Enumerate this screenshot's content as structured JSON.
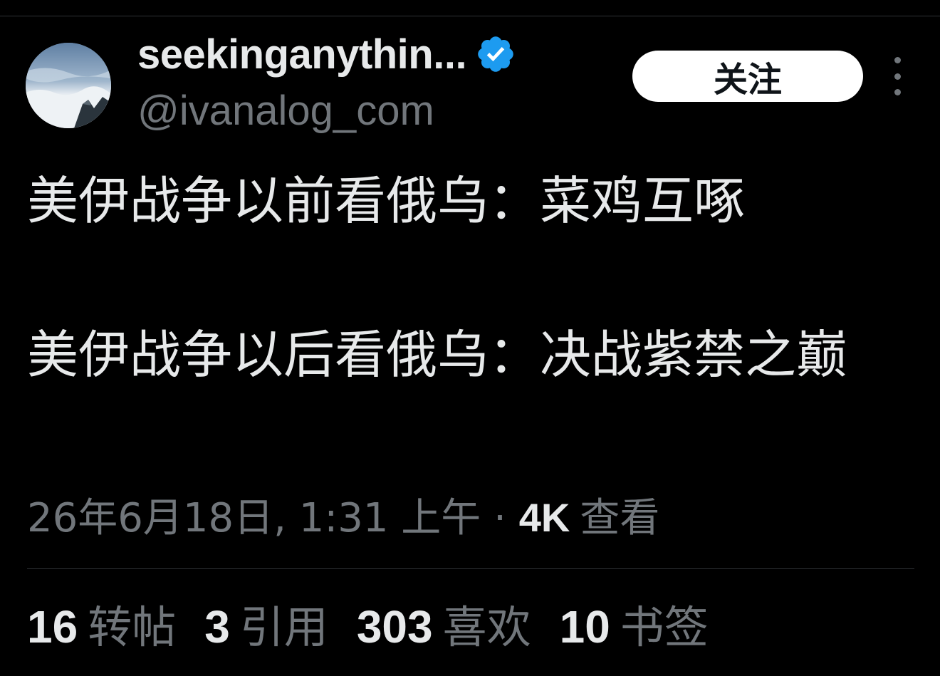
{
  "author": {
    "display_name": "seekinganythin...",
    "handle": "@ivanalog_com",
    "verified": true,
    "verified_color": "#1d9bf0"
  },
  "actions": {
    "follow_label": "关注",
    "more_icon": "more-vertical-icon"
  },
  "tweet": {
    "text": "美伊战争以前看俄乌：菜鸡互啄\n\n美伊战争以后看俄乌：决战紫禁之巅"
  },
  "meta": {
    "timestamp": "26年6月18日, 1:31 上午",
    "separator": " · ",
    "views_count": "4K",
    "views_label": "查看"
  },
  "stats": [
    {
      "count": "16",
      "label": "转帖"
    },
    {
      "count": "3",
      "label": "引用"
    },
    {
      "count": "303",
      "label": "喜欢"
    },
    {
      "count": "10",
      "label": "书签"
    }
  ],
  "colors": {
    "background": "#000000",
    "primary_text": "#e7e9ea",
    "secondary_text": "#71767b",
    "divider": "#2f3336",
    "follow_bg": "#ffffff"
  }
}
